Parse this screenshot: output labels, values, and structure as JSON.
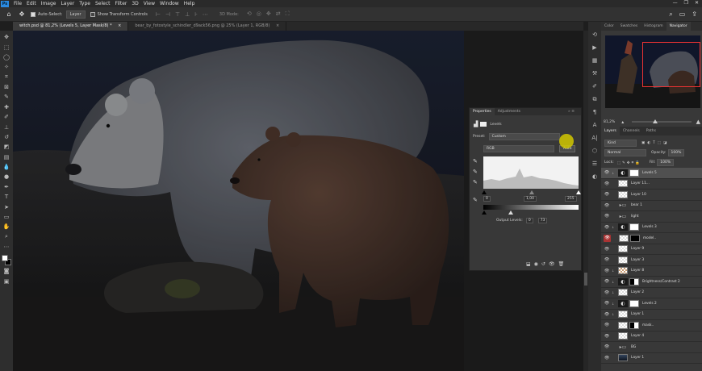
{
  "menubar": {
    "logo": "Ps",
    "items": [
      "File",
      "Edit",
      "Image",
      "Layer",
      "Type",
      "Select",
      "Filter",
      "3D",
      "View",
      "Window",
      "Help"
    ]
  },
  "options": {
    "auto_select_label": "Auto-Select:",
    "auto_select_value": "Layer",
    "show_transform": "Show Transform Controls",
    "mode_3d": "3D Mode:"
  },
  "tabs": [
    {
      "label": "witch.psd @ 81,2% (Levels 5, Layer Mask/8) *",
      "close": "×"
    },
    {
      "label": "bear_by_fotostyle_schindler_d9ack56.png @ 25% (Layer 1, RGB/8)",
      "close": "×"
    }
  ],
  "properties": {
    "tab_properties": "Properties",
    "tab_adjustments": "Adjustments",
    "panel_icons": "»  ≡",
    "title": "Levels",
    "preset_label": "Preset:",
    "preset_value": "Custom",
    "channel_value": "RGB",
    "auto_label": "Auto",
    "input_black": "0",
    "input_mid": "1,00",
    "input_white": "255",
    "output_label": "Output Levels:",
    "output_black": "0",
    "output_white": "73",
    "histogram_fill": "#d8d8d8",
    "slider_icon": "eyedropper-icon"
  },
  "right_tabs": [
    "Color",
    "Swatches",
    "Histogram",
    "Navigator"
  ],
  "navigator": {
    "zoom": "81,2%"
  },
  "layers_panel": {
    "tabs": [
      "Layers",
      "Channels",
      "Paths"
    ],
    "filter": "Kind",
    "blend": "Normal",
    "opacity_label": "Opacity:",
    "opacity_value": "100%",
    "lock_label": "Lock:",
    "fill_label": "Fill:",
    "fill_value": "100%"
  },
  "layers": [
    {
      "name": "Levels 5",
      "thumb": "adj",
      "mask": "white",
      "clip": "↓",
      "selected": true
    },
    {
      "name": "Layer 11...",
      "thumb": "chk",
      "mask": "",
      "clip": ""
    },
    {
      "name": "Layer 10",
      "thumb": "chk",
      "mask": "",
      "clip": ""
    },
    {
      "name": "bear 1",
      "thumb": "grp",
      "mask": "",
      "clip": ""
    },
    {
      "name": "light",
      "thumb": "grp",
      "mask": "",
      "clip": ""
    },
    {
      "name": "Levels 3",
      "thumb": "adj",
      "mask": "white",
      "clip": "↓"
    },
    {
      "name": "model..",
      "thumb": "chk",
      "mask": "black",
      "clip": "",
      "red": true
    },
    {
      "name": "Layer 9",
      "thumb": "chk",
      "mask": "",
      "clip": ""
    },
    {
      "name": "Layer 3",
      "thumb": "chk",
      "mask": "",
      "clip": ""
    },
    {
      "name": "Layer 8",
      "thumb": "warm",
      "mask": "",
      "clip": "↓"
    },
    {
      "name": "Brightness/Contrast 2",
      "thumb": "adj",
      "mask": "mix",
      "clip": "↓"
    },
    {
      "name": "Layer 2",
      "thumb": "chk",
      "mask": "",
      "clip": "↓"
    },
    {
      "name": "Levels 2",
      "thumb": "adj",
      "mask": "white",
      "clip": "↓"
    },
    {
      "name": "Layer 1",
      "thumb": "chk",
      "mask": "",
      "clip": "↓"
    },
    {
      "name": "mask..",
      "thumb": "chk",
      "mask": "mix",
      "clip": ""
    },
    {
      "name": "Layer 4",
      "thumb": "chk",
      "mask": "",
      "clip": ""
    },
    {
      "name": "BG",
      "thumb": "grp",
      "mask": "",
      "clip": ""
    },
    {
      "name": "Layer 1",
      "thumb": "img",
      "mask": "",
      "clip": ""
    }
  ]
}
